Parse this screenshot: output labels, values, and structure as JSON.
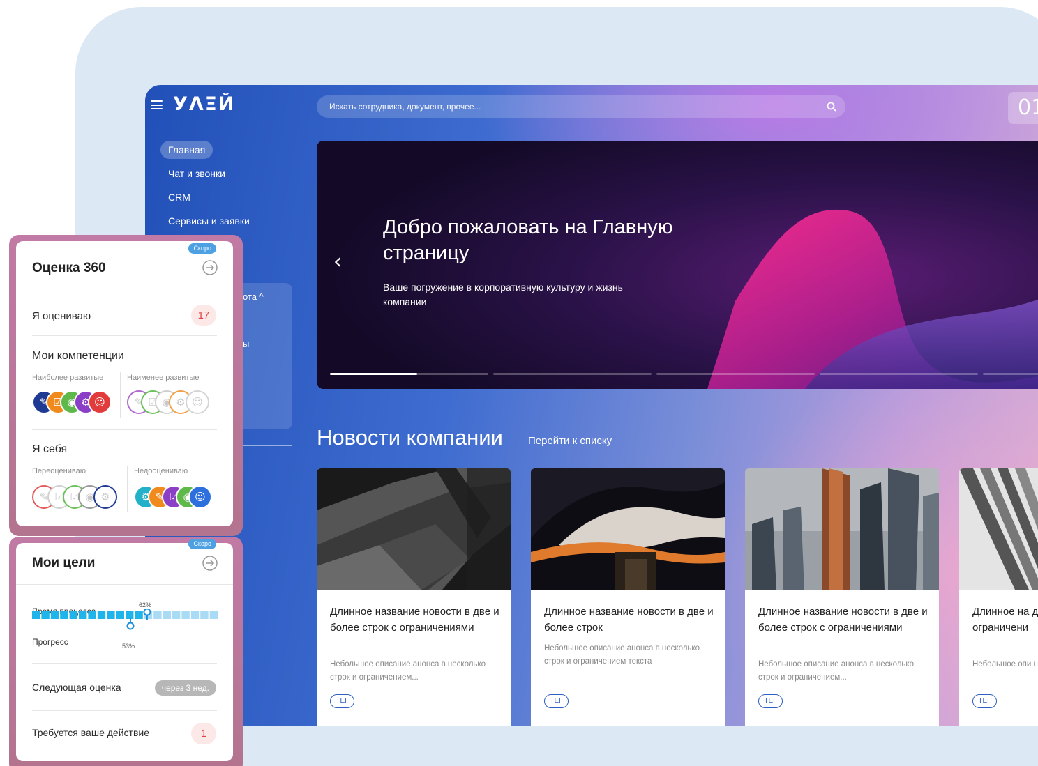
{
  "app": {
    "logo": "УΛΞЙ",
    "search_placeholder": "Искать сотрудника, документ, прочее...",
    "date_partial": "01"
  },
  "nav": {
    "items": [
      "Главная",
      "Чат и звонки",
      "CRM",
      "Сервисы и заявки"
    ],
    "partial_label_1": "ота ^",
    "partial_label_2": "ы"
  },
  "hero": {
    "title": "Добро пожаловать на Главную страницу",
    "subtitle": "Ваше погружение в корпоративную культуру и жизнь компании",
    "prev_icon": "chevron-left-icon",
    "slides_total": 5,
    "active_slide": 1,
    "active_slide_progress": 0.55
  },
  "news": {
    "title": "Новости компании",
    "link": "Перейти к списку",
    "cards": [
      {
        "title": "Длинное название новости в две и более строк с ограничениями",
        "desc": "Небольшое описание анонса в несколько строк и ограничением...",
        "tag": "ТЕГ"
      },
      {
        "title": "Длинное название новости в две и более строк",
        "desc": "Небольшое описание анонса в несколько строк и ограничением текста",
        "tag": "ТЕГ"
      },
      {
        "title": "Длинное название новости в две и более строк с ограничениями",
        "desc": "Небольшое описание анонса в несколько строк и ограничением...",
        "tag": "ТЕГ"
      },
      {
        "title": "Длинное на две и более ограничени",
        "desc": "Небольшое опи несколько стро",
        "tag": "ТЕГ"
      }
    ]
  },
  "widget360": {
    "soon": "Скоро",
    "title": "Оценка 360",
    "i_rate": "Я оцениваю",
    "i_rate_count": "17",
    "competencies": "Мои компетенции",
    "most_developed": "Наиболее развитые",
    "least_developed": "Наименее развитые",
    "self": "Я себя",
    "overestimate": "Переоцениваю",
    "underestimate": "Недооцениваю",
    "colors": {
      "navy": "#1f3a93",
      "orange": "#f08a1c",
      "green": "#5fb84a",
      "purple": "#8b3fc7",
      "red": "#e23b3b",
      "teal": "#23b0c9",
      "blue": "#2d6fdc"
    }
  },
  "goals": {
    "soon": "Скоро",
    "title": "Мои цели",
    "process_time": "Время процесса",
    "process_pct": "62%",
    "progress": "Прогресс",
    "progress_pct": "53%",
    "next_eval": "Следующая оценка",
    "next_eval_value": "через 3 нед.",
    "action_required": "Требуется ваше действие",
    "action_count": "1"
  }
}
